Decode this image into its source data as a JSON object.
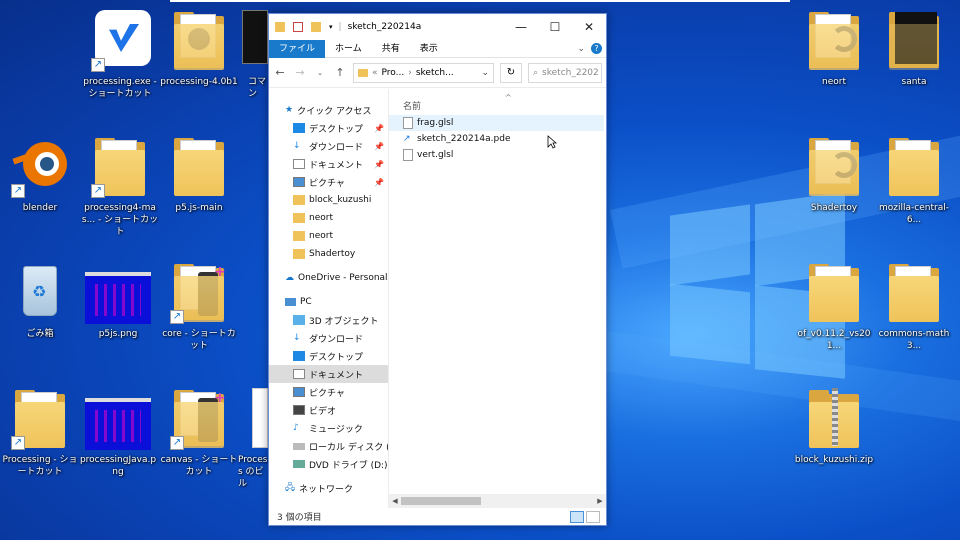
{
  "colors": {
    "desktop_top": "#082f8c",
    "desktop_glow": "#4aa8ff",
    "folder": "#efc35a",
    "ribbon_file_tab": "#1979ca",
    "nav_selected": "#dcdcdc",
    "row_hover": "#e5f3ff"
  },
  "desktop": {
    "left_icons": [
      {
        "label": "processing.exe - ショートカット",
        "icon": "processing-exe-icon"
      },
      {
        "label": "processing-4.0b1",
        "icon": "folder-icon"
      },
      {
        "label": "コマン",
        "icon": "console-icon"
      },
      {
        "label": "blender",
        "icon": "blender-icon"
      },
      {
        "label": "processing4-mas... - ショートカット",
        "icon": "folder-icon"
      },
      {
        "label": "p5.js-main",
        "icon": "folder-icon"
      },
      {
        "label": "ごみ箱",
        "icon": "recycle-bin-icon"
      },
      {
        "label": "p5js.png",
        "icon": "image-icon"
      },
      {
        "label": "core - ショートカット",
        "icon": "folder-icon"
      },
      {
        "label": "Processing - ショートカット",
        "icon": "folder-icon"
      },
      {
        "label": "processingJava.png",
        "icon": "image-icon"
      },
      {
        "label": "canvas - ショートカット",
        "icon": "folder-icon"
      },
      {
        "label": "Process のビル",
        "icon": "document-icon"
      }
    ],
    "right_icons": [
      {
        "label": "neort",
        "icon": "folder-icon"
      },
      {
        "label": "santa",
        "icon": "folder-icon"
      },
      {
        "label": "Shadertoy",
        "icon": "folder-icon"
      },
      {
        "label": "mozilla-central-6...",
        "icon": "folder-icon"
      },
      {
        "label": "of_v0.11.2_vs201...",
        "icon": "folder-icon"
      },
      {
        "label": "commons-math3...",
        "icon": "folder-icon"
      },
      {
        "label": "block_kuzushi.zip",
        "icon": "zip-folder-icon"
      }
    ]
  },
  "explorer": {
    "title": "sketch_220214a",
    "ribbon_tabs": [
      "ファイル",
      "ホーム",
      "共有",
      "表示"
    ],
    "address": {
      "segments": [
        "Pro...",
        "sketch..."
      ],
      "search_placeholder": "sketch_2202"
    },
    "nav": {
      "quick_access": "クイック アクセス",
      "quick_items": [
        {
          "label": "デスクトップ",
          "pinned": true
        },
        {
          "label": "ダウンロード",
          "pinned": true
        },
        {
          "label": "ドキュメント",
          "pinned": true
        },
        {
          "label": "ピクチャ",
          "pinned": true
        },
        {
          "label": "block_kuzushi",
          "pinned": false
        },
        {
          "label": "neort",
          "pinned": false
        },
        {
          "label": "neort",
          "pinned": false
        },
        {
          "label": "Shadertoy",
          "pinned": false
        }
      ],
      "onedrive": "OneDrive - Personal",
      "pc": "PC",
      "pc_items": [
        {
          "label": "3D オブジェクト",
          "selected": false
        },
        {
          "label": "ダウンロード",
          "selected": false
        },
        {
          "label": "デスクトップ",
          "selected": false
        },
        {
          "label": "ドキュメント",
          "selected": true
        },
        {
          "label": "ピクチャ",
          "selected": false
        },
        {
          "label": "ビデオ",
          "selected": false
        },
        {
          "label": "ミュージック",
          "selected": false
        },
        {
          "label": "ローカル ディスク (C:)",
          "selected": false
        },
        {
          "label": "DVD ドライブ (D:) ESD",
          "selected": false
        }
      ],
      "network": "ネットワーク"
    },
    "column_header": "名前",
    "files": [
      {
        "name": "frag.glsl",
        "hover": true,
        "icon": "document-icon"
      },
      {
        "name": "sketch_220214a.pde",
        "hover": false,
        "icon": "processing-file-icon"
      },
      {
        "name": "vert.glsl",
        "hover": false,
        "icon": "document-icon"
      }
    ],
    "status_text": "3 個の項目"
  }
}
